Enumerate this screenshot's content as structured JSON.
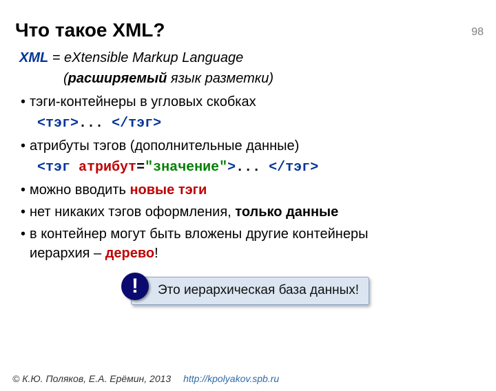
{
  "page_number": "98",
  "title": "Что такое XML?",
  "definition": {
    "abbr": "XML",
    "eq": " = ",
    "expansion": "eXtensible Markup Language",
    "sub_open": "(",
    "sub_bold": "расширяемый",
    "sub_rest": " язык разметки)"
  },
  "bullets": [
    {
      "text": "тэги-контейнеры в угловых скобках"
    },
    {
      "text": "атрибуты тэгов (дополнительные данные)"
    },
    {
      "pre": "можно вводить ",
      "red": "новые тэги"
    },
    {
      "pre": "нет никаких тэгов оформления, ",
      "bold": "только данные"
    },
    {
      "line1": "в контейнер могут быть вложены другие контейнеры",
      "line2_a": "иерархия – ",
      "line2_b": "дерево",
      "line2_c": "!"
    }
  ],
  "code1": {
    "open_lt": "<",
    "open_tag": "тэг",
    "open_gt": ">",
    "mid": "... ",
    "close_lt": "</",
    "close_tag": "тэг",
    "close_gt": ">"
  },
  "code2": {
    "open_lt": "<",
    "open_tag": "тэг",
    "sp": " ",
    "attr": "атрибут",
    "eq": "=",
    "q1": "\"",
    "val": "значение",
    "q2": "\"",
    "open_gt": ">",
    "mid": "... ",
    "close_lt": "</",
    "close_tag": "тэг",
    "close_gt": ">"
  },
  "callout": {
    "mark": "!",
    "text": "Это иерархическая база данных!"
  },
  "footer": {
    "copyright": "© К.Ю. Поляков, Е.А. Ерёмин, 2013",
    "url": "http://kpolyakov.spb.ru"
  }
}
